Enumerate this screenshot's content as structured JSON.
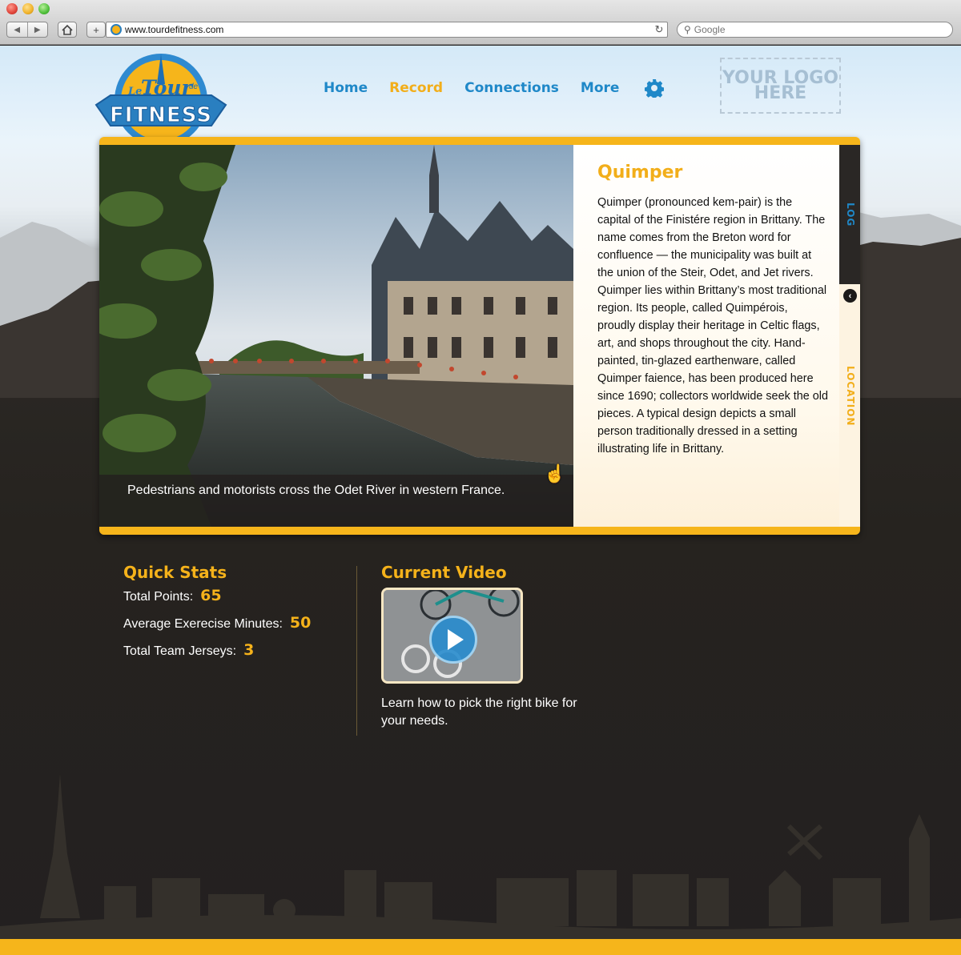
{
  "browser": {
    "url": "www.tourdefitness.com",
    "search_placeholder": "Google"
  },
  "header": {
    "logo": {
      "le": "Le",
      "tour": "Tour",
      "de": "de",
      "fitness": "FITNESS"
    },
    "nav": [
      "Home",
      "Record",
      "Connections",
      "More"
    ],
    "active_nav": "Record",
    "your_logo": "YOUR LOGO HERE"
  },
  "feature": {
    "caption": "Pedestrians and motorists cross the Odet River in western France.",
    "title": "Quimper",
    "body": "Quimper (pronounced kem-pair) is the capital of the Finistére region in Brittany. The name comes from the Breton word for confluence — the municipality was built at the union of the Steir, Odet, and Jet rivers. Quimper lies within Brittany’s most traditional region. Its people, called Quimpérois, proudly display their heritage in Celtic flags, art, and shops throughout the city. Hand-painted, tin-glazed earthenware, called Quimper faience, has been produced here since 1690; collectors worldwide seek the old pieces. A typical design depicts a small person traditionally dressed in a setting illustrating life in Brittany.",
    "tabs": {
      "log": "LOG",
      "location": "LOCATION"
    }
  },
  "quick_stats": {
    "title": "Quick Stats",
    "items": [
      {
        "label": "Total Points:",
        "value": "65"
      },
      {
        "label": "Average Exerecise Minutes:",
        "value": "50"
      },
      {
        "label": "Total Team Jerseys:",
        "value": "3"
      }
    ]
  },
  "current_video": {
    "title": "Current Video",
    "description": "Learn how to pick the right bike for your needs."
  },
  "colors": {
    "accent_yellow": "#f6b51b",
    "nav_blue": "#1f88c8",
    "dark_bg": "#252220"
  },
  "icons": {
    "back": "back-arrow-icon",
    "forward": "forward-arrow-icon",
    "home": "home-icon",
    "add": "plus-icon",
    "reload": "reload-icon",
    "search": "magnifier-icon",
    "settings": "gear-icon",
    "collapse": "chevron-left-icon",
    "play": "play-icon"
  }
}
